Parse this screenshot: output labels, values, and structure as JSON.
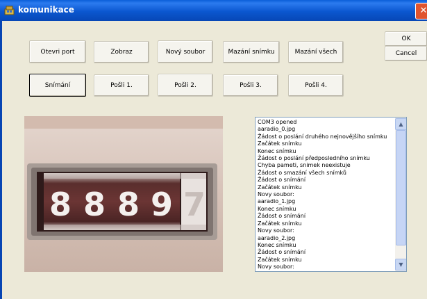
{
  "window": {
    "title": "komunikace",
    "icon": "app-icon",
    "close_symbol": "✕"
  },
  "dialog_buttons": {
    "ok": "OK",
    "cancel": "Cancel"
  },
  "row1": [
    "Otevri port",
    "Zobraz",
    "Nový soubor",
    "Mazání snímku",
    "Mazání všech"
  ],
  "row2": [
    "Snímání",
    "Pošli 1.",
    "Pošli 2.",
    "Pošli 3.",
    "Pošli 4."
  ],
  "photo": {
    "counter_digits": [
      "8",
      "8",
      "8",
      "9",
      "7"
    ]
  },
  "log": [
    " COM3 opened",
    "aaradio_0.jpg",
    "Žádost o poslání druhého nejnovějšího snímku",
    "Začátek snímku",
    "Konec snímku",
    "Žádost o poslání předposledního snímku",
    "Chyba pameti, snimek neexistuje",
    "Žádost o smazání všech snímků",
    "Žádost o snímání",
    "Začátek snímku",
    "Novy soubor:",
    "aaradio_1.jpg",
    "Konec snímku",
    "Žádost o snímání",
    "Začátek snímku",
    "Novy soubor:",
    "aaradio_2.jpg",
    "Konec snímku",
    "Žádost o snímání",
    "Začátek snímku",
    "Novy soubor:"
  ],
  "scrollbar": {
    "up_symbol": "▲",
    "down_symbol": "▼"
  }
}
